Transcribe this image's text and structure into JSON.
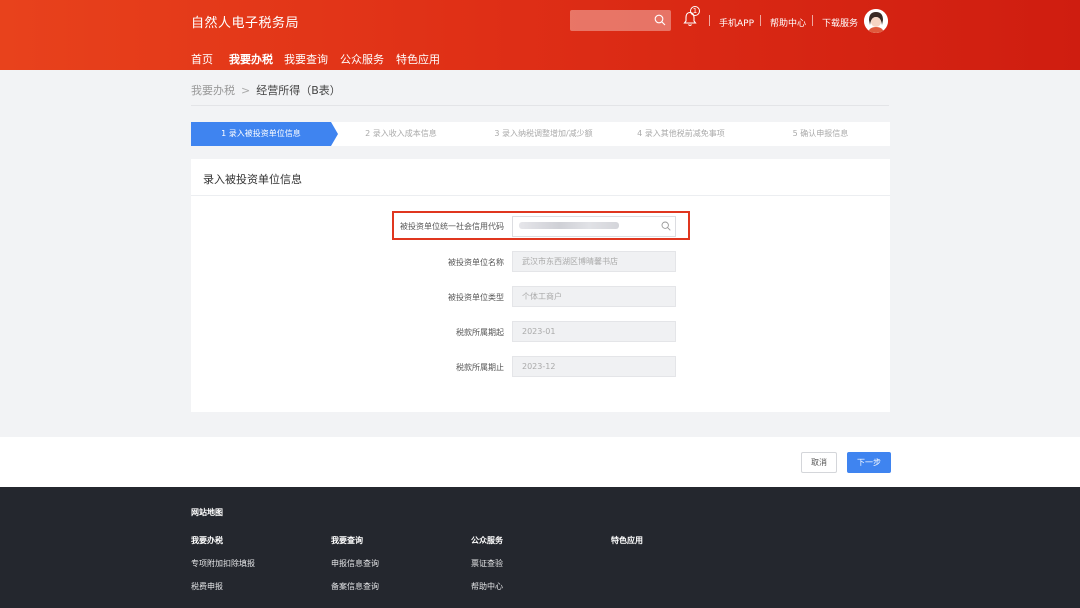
{
  "header": {
    "brand": "自然人电子税务局",
    "bell_badge": "1",
    "links": [
      "手机APP",
      "帮助中心",
      "下载服务"
    ],
    "nav": [
      "首页",
      "我要办税",
      "我要查询",
      "公众服务",
      "特色应用"
    ],
    "active_nav_index": 1
  },
  "breadcrumb": {
    "parent": "我要办税",
    "separator": ">",
    "current": "经营所得（B表）"
  },
  "steps": [
    "1  录入被投资单位信息",
    "2  录入收入成本信息",
    "3  录入纳税调整增加/减少额",
    "4  录入其他税前减免事项",
    "5  确认申报信息"
  ],
  "active_step_index": 0,
  "form": {
    "section_title": "录入被投资单位信息",
    "fields": [
      {
        "label": "被投资单位统一社会信用代码",
        "value": ""
      },
      {
        "label": "被投资单位名称",
        "value": "武汉市东西湖区博晴馨书店"
      },
      {
        "label": "被投资单位类型",
        "value": "个体工商户"
      },
      {
        "label": "税款所属期起",
        "value": "2023-01"
      },
      {
        "label": "税款所属期止",
        "value": "2023-12"
      }
    ]
  },
  "actions": {
    "cancel": "取消",
    "next": "下一步"
  },
  "footer": {
    "title": "网站地图",
    "columns": [
      {
        "head": "我要办税",
        "items": [
          "专项附加扣除填报",
          "税费申报"
        ]
      },
      {
        "head": "我要查询",
        "items": [
          "申报信息查询",
          "备案信息查询"
        ]
      },
      {
        "head": "公众服务",
        "items": [
          "票证查验",
          "帮助中心"
        ]
      },
      {
        "head": "特色应用",
        "items": []
      }
    ]
  },
  "colors": {
    "header_start": "#e8421c",
    "header_end": "#cf1d10",
    "step_active": "#3f84f0",
    "button_primary": "#3f84f0",
    "highlight_border": "#e0361f",
    "footer_bg": "#24272e"
  }
}
